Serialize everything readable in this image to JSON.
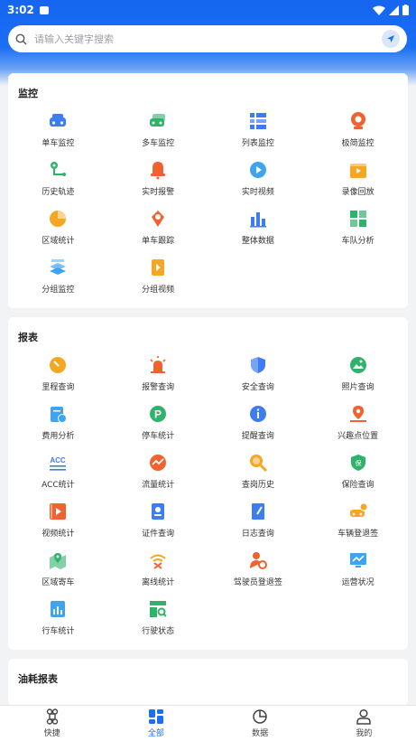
{
  "status_bar": {
    "time": "3:02"
  },
  "search": {
    "placeholder": "请输入关键字搜索"
  },
  "sections": [
    {
      "title": "监控",
      "items": [
        {
          "label": "单车监控",
          "icon": "car-icon",
          "color": "#3e7cf1"
        },
        {
          "label": "多车监控",
          "icon": "multi-car-icon",
          "color": "#2fb36b"
        },
        {
          "label": "列表监控",
          "icon": "list-icon",
          "color": "#3e7cf1"
        },
        {
          "label": "极简监控",
          "icon": "camera-icon",
          "color": "#f0622f"
        },
        {
          "label": "历史轨迹",
          "icon": "route-icon",
          "color": "#2fb36b"
        },
        {
          "label": "实时报警",
          "icon": "bell-icon",
          "color": "#f0622f"
        },
        {
          "label": "实时视频",
          "icon": "play-icon",
          "color": "#3fa3ef"
        },
        {
          "label": "录像回放",
          "icon": "clapper-icon",
          "color": "#f5a623"
        },
        {
          "label": "区域统计",
          "icon": "pie-icon",
          "color": "#f5a623"
        },
        {
          "label": "单车跟踪",
          "icon": "target-pin-icon",
          "color": "#f0622f"
        },
        {
          "label": "整体数据",
          "icon": "bar-chart-icon",
          "color": "#3e7cf1"
        },
        {
          "label": "车队分析",
          "icon": "grid-icon",
          "color": "#2fb36b"
        },
        {
          "label": "分组监控",
          "icon": "layers-icon",
          "color": "#3fa3ef"
        },
        {
          "label": "分组视频",
          "icon": "video-file-icon",
          "color": "#f5a623"
        }
      ]
    },
    {
      "title": "报表",
      "items": [
        {
          "label": "里程查询",
          "icon": "gauge-icon",
          "color": "#f5a623"
        },
        {
          "label": "报警查询",
          "icon": "alarm-light-icon",
          "color": "#f0622f"
        },
        {
          "label": "安全查询",
          "icon": "shield-icon",
          "color": "#3e7cf1"
        },
        {
          "label": "照片查询",
          "icon": "photo-icon",
          "color": "#2fb36b"
        },
        {
          "label": "费用分析",
          "icon": "bill-icon",
          "color": "#3fa3ef"
        },
        {
          "label": "停车统计",
          "icon": "parking-icon",
          "color": "#2fb36b"
        },
        {
          "label": "提醒查询",
          "icon": "info-icon",
          "color": "#3e7cf1"
        },
        {
          "label": "兴趣点位置",
          "icon": "poi-icon",
          "color": "#f0622f"
        },
        {
          "label": "ACC统计",
          "icon": "acc-icon",
          "color": "#3e7cf1"
        },
        {
          "label": "流量统计",
          "icon": "trend-icon",
          "color": "#f0622f"
        },
        {
          "label": "查岗历史",
          "icon": "magnifier-icon",
          "color": "#f5a623"
        },
        {
          "label": "保险查询",
          "icon": "insurance-shield-icon",
          "color": "#2fb36b"
        },
        {
          "label": "视频统计",
          "icon": "film-icon",
          "color": "#f0622f"
        },
        {
          "label": "证件查询",
          "icon": "id-card-icon",
          "color": "#3e7cf1"
        },
        {
          "label": "日志查询",
          "icon": "notebook-icon",
          "color": "#3e7cf1"
        },
        {
          "label": "车辆登退签",
          "icon": "car-check-icon",
          "color": "#f5a623"
        },
        {
          "label": "区域寄车",
          "icon": "map-pin-icon",
          "color": "#2fb36b"
        },
        {
          "label": "离线统计",
          "icon": "wifi-off-icon",
          "color": "#f5a623"
        },
        {
          "label": "驾驶员登退签",
          "icon": "driver-icon",
          "color": "#f0622f"
        },
        {
          "label": "运营状况",
          "icon": "monitor-chart-icon",
          "color": "#3fa3ef"
        },
        {
          "label": "行车统计",
          "icon": "stats-board-icon",
          "color": "#3fa3ef"
        },
        {
          "label": "行驶状态",
          "icon": "status-search-icon",
          "color": "#2fb36b"
        }
      ]
    },
    {
      "title": "油耗报表",
      "items": []
    }
  ],
  "tabs": [
    {
      "label": "快捷",
      "icon": "command-icon",
      "active": false
    },
    {
      "label": "全部",
      "icon": "apps-icon",
      "active": true
    },
    {
      "label": "数据",
      "icon": "pie-chart-icon",
      "active": false
    },
    {
      "label": "我的",
      "icon": "user-icon",
      "active": false
    }
  ]
}
